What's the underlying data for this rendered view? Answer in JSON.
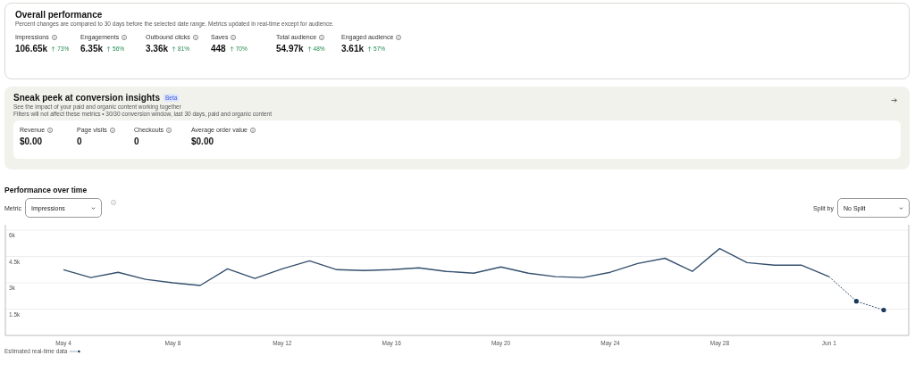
{
  "overall": {
    "title": "Overall performance",
    "subtitle": "Percent changes are compared to 30 days before the selected date range. Metrics updated in real-time except for audience.",
    "metrics": [
      {
        "label": "Impressions",
        "value": "106.65k",
        "change": "73%"
      },
      {
        "label": "Engagements",
        "value": "6.35k",
        "change": "56%"
      },
      {
        "label": "Outbound clicks",
        "value": "3.36k",
        "change": "81%"
      },
      {
        "label": "Saves",
        "value": "448",
        "change": "70%"
      },
      {
        "label": "Total audience",
        "value": "54.97k",
        "change": "48%"
      },
      {
        "label": "Engaged audience",
        "value": "3.61k",
        "change": "57%"
      }
    ]
  },
  "conversion": {
    "title": "Sneak peek at conversion insights",
    "badge": "Beta",
    "subtitle": "See the impact of your paid and organic content working together",
    "note": "Filters will not affect these metrics • 30/30 conversion window, last 30 days, paid and organic content",
    "metrics": [
      {
        "label": "Revenue",
        "value": "$0.00"
      },
      {
        "label": "Page visits",
        "value": "0"
      },
      {
        "label": "Checkouts",
        "value": "0"
      },
      {
        "label": "Average order value",
        "value": "$0.00"
      }
    ]
  },
  "performance": {
    "title": "Performance over time",
    "metric_label": "Metric",
    "metric_value": "Impressions",
    "split_label": "Split by",
    "split_value": "No Split",
    "chart_data": {
      "type": "line",
      "grid": true,
      "categories": [
        "May 4",
        null,
        null,
        null,
        "May 8",
        null,
        null,
        null,
        "May 12",
        null,
        null,
        null,
        "May 16",
        null,
        null,
        null,
        "May 20",
        null,
        null,
        null,
        "May 24",
        null,
        null,
        null,
        "May 28",
        null,
        null,
        null,
        "Jun 1",
        null,
        null
      ],
      "series": [
        {
          "color": "#35506e",
          "line_style": "solid",
          "values": [
            3750,
            3300,
            3600,
            3200,
            3000,
            2850,
            3800,
            3250,
            3800,
            4250,
            3750,
            3700,
            3750,
            3850,
            3650,
            3550,
            3900,
            3550,
            3350,
            3300,
            3600,
            4100,
            4400,
            3650,
            4950,
            4150,
            4000,
            4000,
            3350,
            null,
            null
          ]
        },
        {
          "name": "Estimated real-time data",
          "color": "#1c3a5e",
          "line_style": "dashed",
          "values": [
            null,
            null,
            null,
            null,
            null,
            null,
            null,
            null,
            null,
            null,
            null,
            null,
            null,
            null,
            null,
            null,
            null,
            null,
            null,
            null,
            null,
            null,
            null,
            null,
            null,
            null,
            null,
            null,
            3350,
            1950,
            1450
          ]
        }
      ],
      "ylim": [
        0,
        6000
      ],
      "yticks": [
        {
          "value": 1500,
          "label": "1.5k"
        },
        {
          "value": 3000,
          "label": "3k"
        },
        {
          "value": 4500,
          "label": "4.5k"
        },
        {
          "value": 6000,
          "label": "6k"
        }
      ]
    }
  }
}
